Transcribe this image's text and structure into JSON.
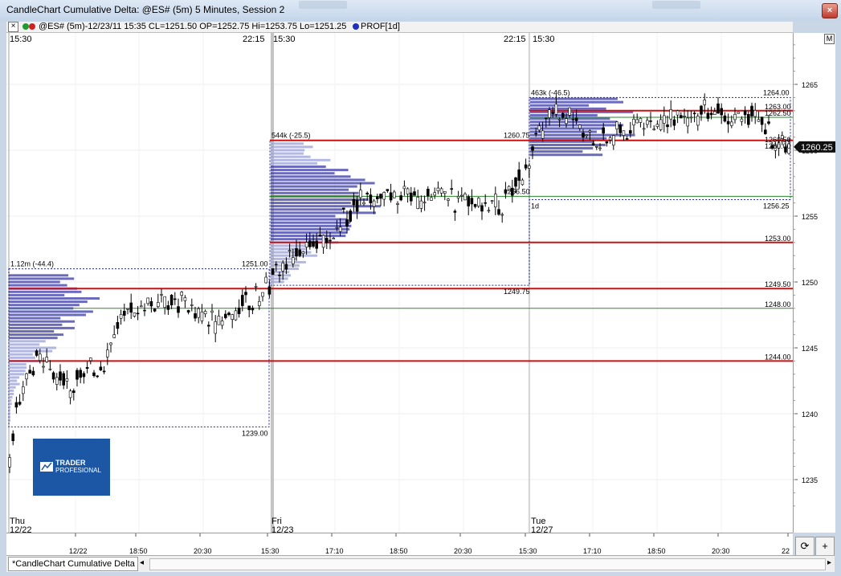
{
  "window": {
    "title": "CandleChart Cumulative Delta: @ES# (5m) 5 Minutes, Session 2",
    "close_glyph": "×"
  },
  "infobar": {
    "close_glyph": "×",
    "quote": "@ES# (5m)-12/23/11 15:35 CL=1251.50 OP=1252.75 Hi=1253.75 Lo=1251.25",
    "study": "PROF[1d]",
    "dot_colors": [
      "#1f9a2e",
      "#cc2222",
      "#1f2fbf"
    ]
  },
  "chart": {
    "session_labels": [
      {
        "text": "15:30"
      },
      {
        "text": "22:15"
      },
      {
        "text": "15:30"
      },
      {
        "text": "22:15"
      },
      {
        "text": "15:30"
      }
    ],
    "day_markers": [
      {
        "day": "Thu",
        "date": "12/22"
      },
      {
        "day": "Fri",
        "date": "12/23"
      },
      {
        "day": "Tue",
        "date": "12/27"
      }
    ],
    "profiles": [
      {
        "title": "1.12m (-44.4)",
        "high": "1251.00",
        "low": "1239.00"
      },
      {
        "title": "544k (-25.5)",
        "high": "1260.75",
        "low": "1249.75",
        "extra": "1256.50"
      },
      {
        "title": "463k (-46.5)",
        "high": "1264.00",
        "low": "1256.25",
        "period": "1d"
      }
    ],
    "level_labels": [
      "1263.00",
      "1262.50",
      "1260.50",
      "1260.00",
      "1253.00",
      "1249.50",
      "1248.00",
      "1244.00"
    ],
    "colors": {
      "level_red": "#cc1111",
      "level_green": "#2a8a2a",
      "profile_blue": "#3a3aa8",
      "profile_light": "#9aa0d8",
      "candle": "#000000"
    }
  },
  "price_axis": {
    "ticks": [
      "1265",
      "1260",
      "1255",
      "1250",
      "1245",
      "1240",
      "1235"
    ],
    "current_price": "1260.25",
    "m_button": "M"
  },
  "time_axis": {
    "ticks": [
      "12/22",
      "18:50",
      "20:30",
      "15:30",
      "17:10",
      "18:50",
      "20:30",
      "15:30",
      "17:10",
      "18:50",
      "20:30",
      "22"
    ]
  },
  "logo": {
    "line1": "TRADER",
    "line2": "PROFESIONAL"
  },
  "bottom": {
    "tab_label": "*CandleChart Cumulative Delta",
    "refresh_glyph": "⟳",
    "plus_glyph": "+",
    "scroll_left": "◂",
    "scroll_right": "▸"
  }
}
